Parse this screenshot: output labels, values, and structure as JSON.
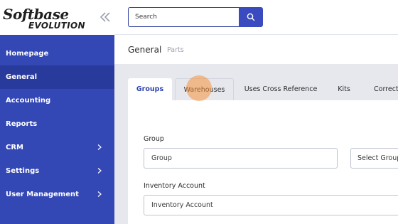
{
  "logo": {
    "line1": "Softbase",
    "line2": "EVOLUTION"
  },
  "sidebar": {
    "items": [
      {
        "label": "Homepage",
        "has_submenu": false,
        "active": false
      },
      {
        "label": "General",
        "has_submenu": false,
        "active": true
      },
      {
        "label": "Accounting",
        "has_submenu": false,
        "active": false
      },
      {
        "label": "Reports",
        "has_submenu": false,
        "active": false
      },
      {
        "label": "CRM",
        "has_submenu": true,
        "active": false
      },
      {
        "label": "Settings",
        "has_submenu": true,
        "active": false
      },
      {
        "label": "User Management",
        "has_submenu": true,
        "active": false
      }
    ]
  },
  "search": {
    "placeholder": "Search"
  },
  "breadcrumb": {
    "title": "General",
    "sub": "Parts"
  },
  "tabs": [
    {
      "label": "Groups",
      "active": true
    },
    {
      "label": "Warehouses",
      "active": false
    },
    {
      "label": "Uses Cross Reference",
      "active": false
    },
    {
      "label": "Kits",
      "active": false
    },
    {
      "label": "Correct",
      "active": false
    }
  ],
  "form": {
    "group_label": "Group",
    "group_placeholder": "Group",
    "select_group": "Select Group",
    "inventory_label": "Inventory Account",
    "inventory_placeholder": "Inventory Account"
  },
  "colors": {
    "sidebar": "#3347b5",
    "sidebar_active": "#283b9c",
    "accent": "#3a4bbf",
    "click_indicator": "#f6923c"
  }
}
